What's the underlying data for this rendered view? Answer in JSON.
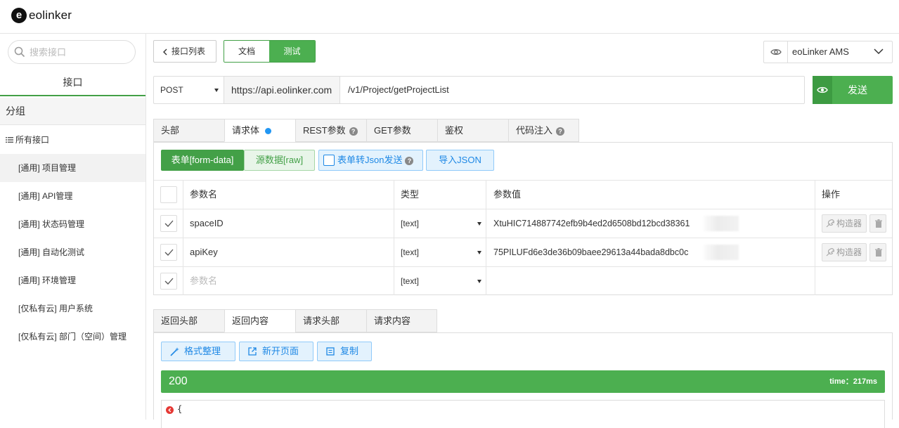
{
  "app": {
    "logo_letter": "e",
    "logo_text": "eolinker"
  },
  "sidebar": {
    "search_placeholder": "搜索接口",
    "tab": "接口",
    "group_header": "分组",
    "all_label": "所有接口",
    "items": [
      {
        "label": "[通用] 项目管理",
        "active": true
      },
      {
        "label": "[通用] API管理"
      },
      {
        "label": "[通用] 状态码管理"
      },
      {
        "label": "[通用] 自动化测试"
      },
      {
        "label": "[通用] 环境管理"
      },
      {
        "label": "[仅私有云] 用户系统"
      },
      {
        "label": "[仅私有云] 部门（空间）管理"
      }
    ]
  },
  "toolbar": {
    "back_label": "接口列表",
    "doc_label": "文档",
    "test_label": "测试",
    "env_label": "eoLinker AMS"
  },
  "request": {
    "method": "POST",
    "host": "https://api.eolinker.com",
    "path": "/v1/Project/getProjectList",
    "send_label": "发送"
  },
  "request_tabs": [
    {
      "label": "头部"
    },
    {
      "label": "请求体",
      "dot": true
    },
    {
      "label": "REST参数",
      "help": "?"
    },
    {
      "label": "GET参数"
    },
    {
      "label": "鉴权"
    },
    {
      "label": "代码注入",
      "help": "?"
    }
  ],
  "body_panel": {
    "form_label": "表单[form-data]",
    "raw_label": "源数据[raw]",
    "to_json_label": "表单转Json发送",
    "help": "?",
    "import_label": "导入JSON",
    "columns": {
      "name": "参数名",
      "type": "类型",
      "value": "参数值",
      "ops": "操作"
    },
    "rows": [
      {
        "name": "spaceID",
        "type": "[text]",
        "value": "XtuHIC714887742efb9b4ed2d6508bd12bcd38361",
        "builder": "构造器"
      },
      {
        "name": "apiKey",
        "type": "[text]",
        "value": "75PILUFd6e3de36b09baee29613a44bada8dbc0c",
        "builder": "构造器"
      }
    ],
    "new_row": {
      "placeholder": "参数名",
      "type": "[text]"
    }
  },
  "response_tabs": [
    {
      "label": "返回头部"
    },
    {
      "label": "返回内容",
      "active": true
    },
    {
      "label": "请求头部"
    },
    {
      "label": "请求内容"
    }
  ],
  "response": {
    "format_label": "格式整理",
    "new_page_label": "新开页面",
    "copy_label": "复制",
    "status_code": "200",
    "time_text": "time：217ms",
    "body_first_line": "{"
  },
  "colors": {
    "accent": "#4caf50",
    "accent_dark": "#43a047",
    "link": "#1e88e5"
  }
}
